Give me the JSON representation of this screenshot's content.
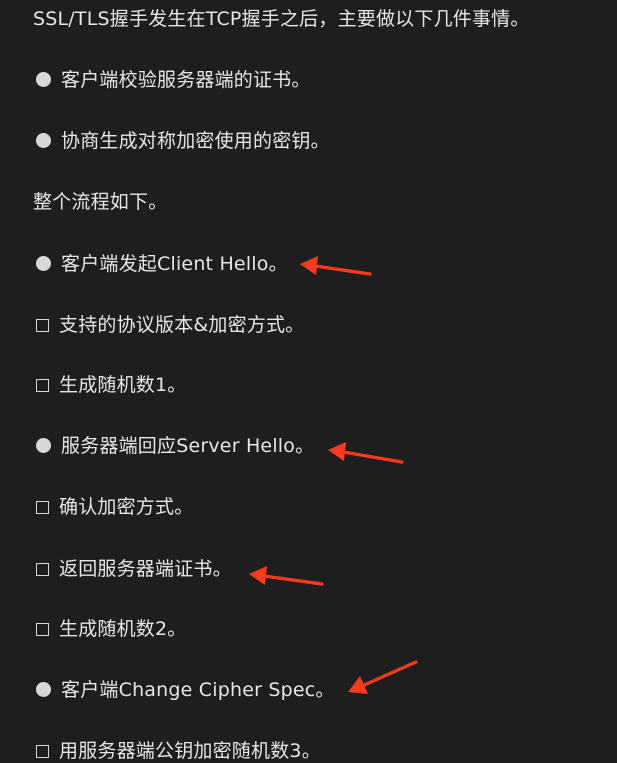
{
  "intro": "SSL/TLS握手发生在TCP握手之后，主要做以下几件事情。",
  "tasks": [
    "客户端校验服务器端的证书。",
    "协商生成对称加密使用的密钥。"
  ],
  "flow_intro": "整个流程如下。",
  "steps": [
    {
      "text": "客户端发起Client Hello。",
      "subs": [
        "支持的协议版本&加密方式。",
        "生成随机数1。"
      ]
    },
    {
      "text": "服务器端回应Server Hello。",
      "subs": [
        "确认加密方式。",
        "返回服务器端证书。",
        "生成随机数2。"
      ]
    },
    {
      "text": "客户端Change Cipher Spec。",
      "subs": [
        "用服务器端公钥加密随机数3。"
      ]
    }
  ],
  "annotation_color": "#ff3b1f"
}
